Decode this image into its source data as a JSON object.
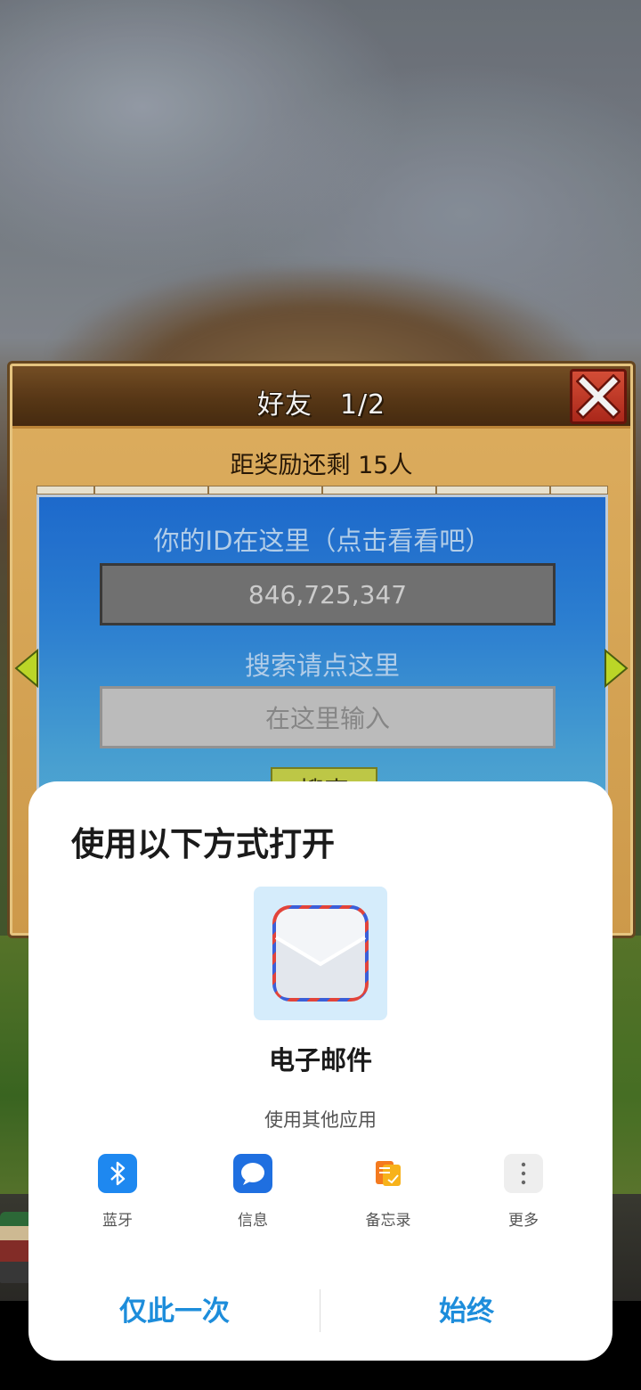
{
  "game": {
    "title": "好友　1/2",
    "reward_text": "距奖励还剩 15人",
    "id_label": "你的ID在这里（点击看看吧）",
    "id_value": "846,725,347",
    "search_label": "搜索请点这里",
    "search_placeholder": "在这里输入",
    "search_button": "搜索"
  },
  "sheet": {
    "title": "使用以下方式打开",
    "primary_app": {
      "name": "电子邮件",
      "icon": "email-icon"
    },
    "other_apps_label": "使用其他应用",
    "share_items": [
      {
        "label": "蓝牙",
        "icon": "bluetooth-icon",
        "color": "#1e88f0"
      },
      {
        "label": "信息",
        "icon": "message-icon",
        "color": "#1f6fe0"
      },
      {
        "label": "备忘录",
        "icon": "notes-icon",
        "color": "#f7a01b"
      },
      {
        "label": "更多",
        "icon": "more-icon",
        "color": "#eeeeee"
      }
    ],
    "actions": {
      "once": "仅此一次",
      "always": "始终"
    }
  },
  "colors": {
    "accent": "#1d8ddb",
    "game_panel_blue": "#2f86dc",
    "game_frame": "#d9a24f"
  }
}
